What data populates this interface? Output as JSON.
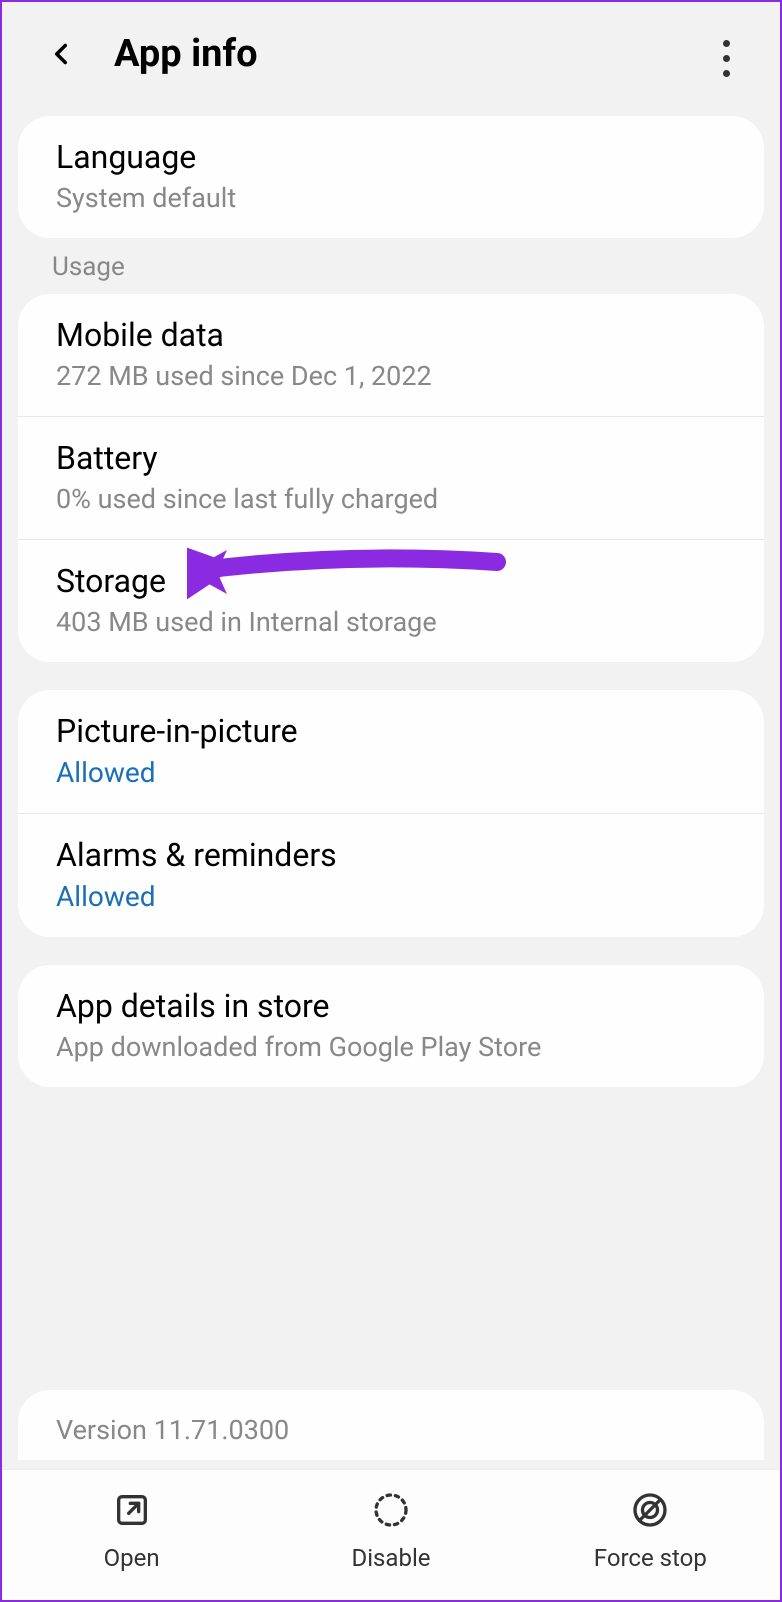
{
  "header": {
    "title": "App info"
  },
  "rows": {
    "language": {
      "title": "Language",
      "sub": "System default"
    },
    "usage_header": "Usage",
    "mobile_data": {
      "title": "Mobile data",
      "sub": "272 MB used since Dec 1, 2022"
    },
    "battery": {
      "title": "Battery",
      "sub": "0% used since last fully charged"
    },
    "storage": {
      "title": "Storage",
      "sub": "403 MB used in Internal storage"
    },
    "pip": {
      "title": "Picture-in-picture",
      "sub": "Allowed"
    },
    "alarms": {
      "title": "Alarms & reminders",
      "sub": "Allowed"
    },
    "app_details": {
      "title": "App details in store",
      "sub": "App downloaded from Google Play Store"
    },
    "version": "Version 11.71.0300"
  },
  "bottom": {
    "open": "Open",
    "disable": "Disable",
    "force_stop": "Force stop"
  }
}
